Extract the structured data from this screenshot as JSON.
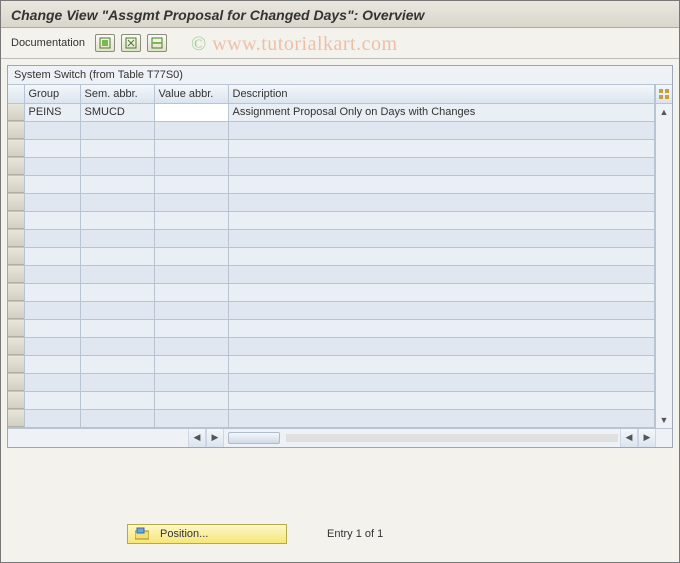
{
  "header": {
    "title": "Change View \"Assgmt Proposal for Changed Days\": Overview"
  },
  "toolbar": {
    "documentation_label": "Documentation"
  },
  "panel": {
    "title": "System Switch (from Table T77S0)"
  },
  "columns": {
    "group": "Group",
    "sem_abbr": "Sem. abbr.",
    "value_abbr": "Value abbr.",
    "description": "Description"
  },
  "rows": [
    {
      "group": "PEINS",
      "sem_abbr": "SMUCD",
      "value_abbr": "",
      "description": "Assignment Proposal Only on Days with Changes"
    }
  ],
  "footer": {
    "position_label": "Position...",
    "entry_label": "Entry 1 of 1"
  },
  "watermark": {
    "copy": "©",
    "text": " www.tutorialkart.com"
  }
}
